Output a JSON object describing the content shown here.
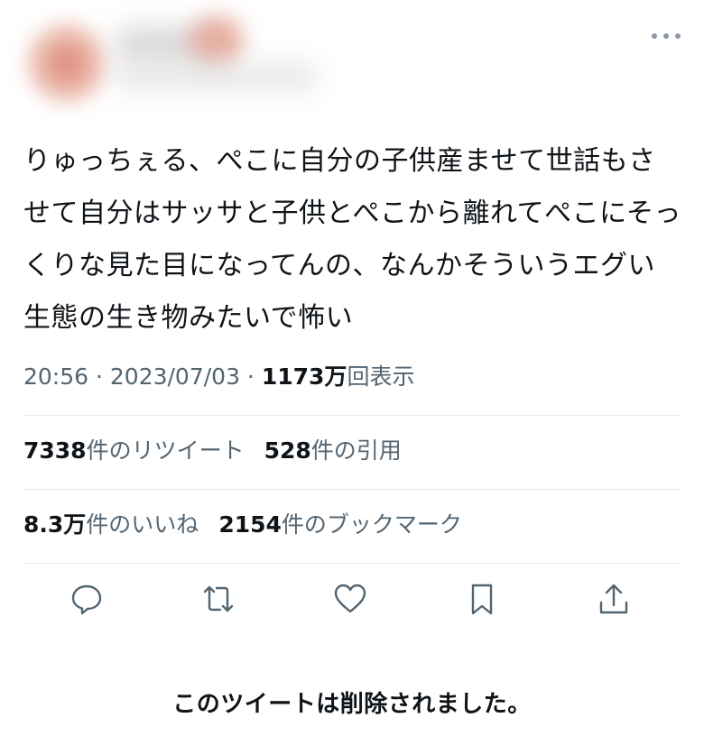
{
  "tweet": {
    "text": "りゅっちぇる、ぺこに自分の子供産ませて世話もさせて自分はサッサと子供とぺこから離れてぺこにそっくりな見た目になってんの、なんかそういうエグい生態の生き物みたいで怖い",
    "time": "20:56",
    "date": "2023/07/03",
    "separator": " · ",
    "views_number": "1173",
    "views_unit": "万",
    "views_label": "回表示"
  },
  "stats": {
    "retweets_num": "7338",
    "retweets_label": "件のリツイート",
    "quotes_num": "528",
    "quotes_label": "件の引用",
    "likes_num": "8.3万",
    "likes_label": "件のいいね",
    "bookmarks_num": "2154",
    "bookmarks_label": "件のブックマーク"
  },
  "actions": [
    {
      "name": "reply",
      "icon": "reply-icon"
    },
    {
      "name": "retweet",
      "icon": "retweet-icon"
    },
    {
      "name": "like",
      "icon": "heart-icon"
    },
    {
      "name": "bookmark",
      "icon": "bookmark-icon"
    },
    {
      "name": "share",
      "icon": "share-icon"
    }
  ],
  "notice": {
    "deleted_text": "このツイートは削除されました。"
  },
  "colors": {
    "text_primary": "#0f1419",
    "text_secondary": "#536471",
    "divider": "#e6e9eb",
    "icon": "#536471"
  }
}
